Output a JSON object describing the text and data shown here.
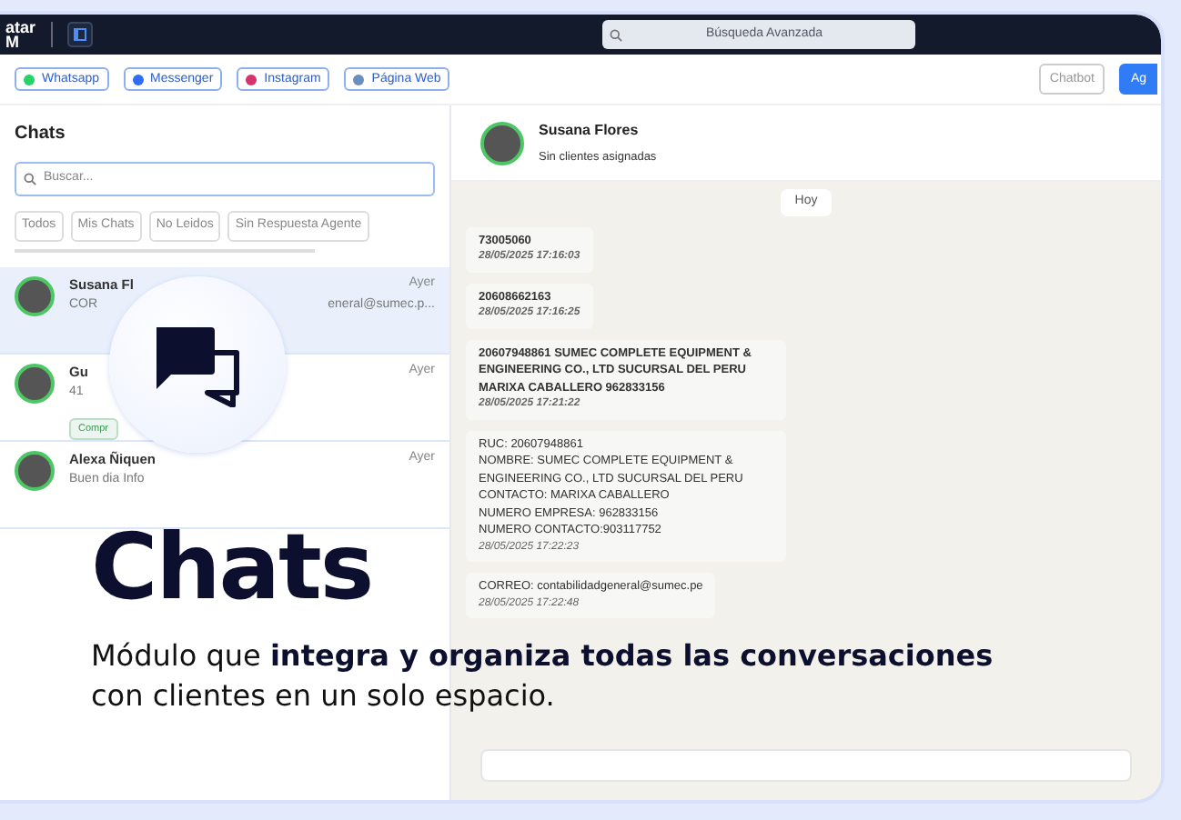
{
  "topbar": {
    "logo_line_1": "atar",
    "logo_line_2": "M",
    "search_placeholder": "Búsqueda Avanzada"
  },
  "channels": [
    {
      "label": "Whatsapp",
      "color": "#25d366"
    },
    {
      "label": "Messenger",
      "color": "#2f6df6"
    },
    {
      "label": "Instagram",
      "color": "#d6336c"
    },
    {
      "label": "Página Web",
      "color": "#6c8ebf"
    }
  ],
  "action_buttons": [
    {
      "label": "Chatbot",
      "kind": "outline"
    },
    {
      "label": "Ag",
      "kind": "primary"
    }
  ],
  "sidebar": {
    "title": "Chats",
    "search_placeholder": "Buscar...",
    "filters": [
      {
        "label": "Todos",
        "selected": false
      },
      {
        "label": "Mis Chats",
        "selected": false
      },
      {
        "label": "No Leidos",
        "selected": false
      },
      {
        "label": "Sin Respuesta Agente",
        "selected": false
      }
    ],
    "chats": [
      {
        "name": "Susana Fl",
        "preview": "COR",
        "preview_end": "eneral@sumec.p...",
        "time": "Ayer",
        "selected": true
      },
      {
        "name": "Gu",
        "preview": "41",
        "tag": "Compr",
        "color": "#3a9a52",
        "time": "Ayer",
        "selected": false
      },
      {
        "name": "Alexa Ñiquen",
        "preview": "Buen dia Info",
        "time": "Ayer",
        "selected": false
      }
    ]
  },
  "conversation": {
    "contact_name": "Susana Flores",
    "contact_subtitle": "Sin clientes asignadas",
    "date_chip": "Hoy",
    "messages": [
      {
        "text": "73005060",
        "time": "28/05/2025 17:16:03"
      },
      {
        "text": "20608662163",
        "time": "28/05/2025 17:16:25"
      },
      {
        "text": "20607948861 SUMEC COMPLETE EQUIPMENT & ENGINEERING CO., LTD SUCURSAL DEL PERU MARIXA CABALLERO 962833156",
        "time": "28/05/2025 17:21:22"
      },
      {
        "text": "RUC: 20607948861\nNOMBRE: SUMEC COMPLETE EQUIPMENT & ENGINEERING CO., LTD SUCURSAL DEL PERU\nCONTACTO: MARIXA CABALLERO\nNUMERO EMPRESA: 962833156\nNUMERO CONTACTO:903117752",
        "time": "28/05/2025 17:22:23"
      },
      {
        "text": "CORREO: contabilidadgeneral@sumec.pe",
        "time": "28/05/2025 17:22:48"
      }
    ]
  },
  "hero": {
    "title": "Chats",
    "subtitle": "Módulo que **integra y organiza todas las conversaciones** con clientes en un solo espacio."
  }
}
